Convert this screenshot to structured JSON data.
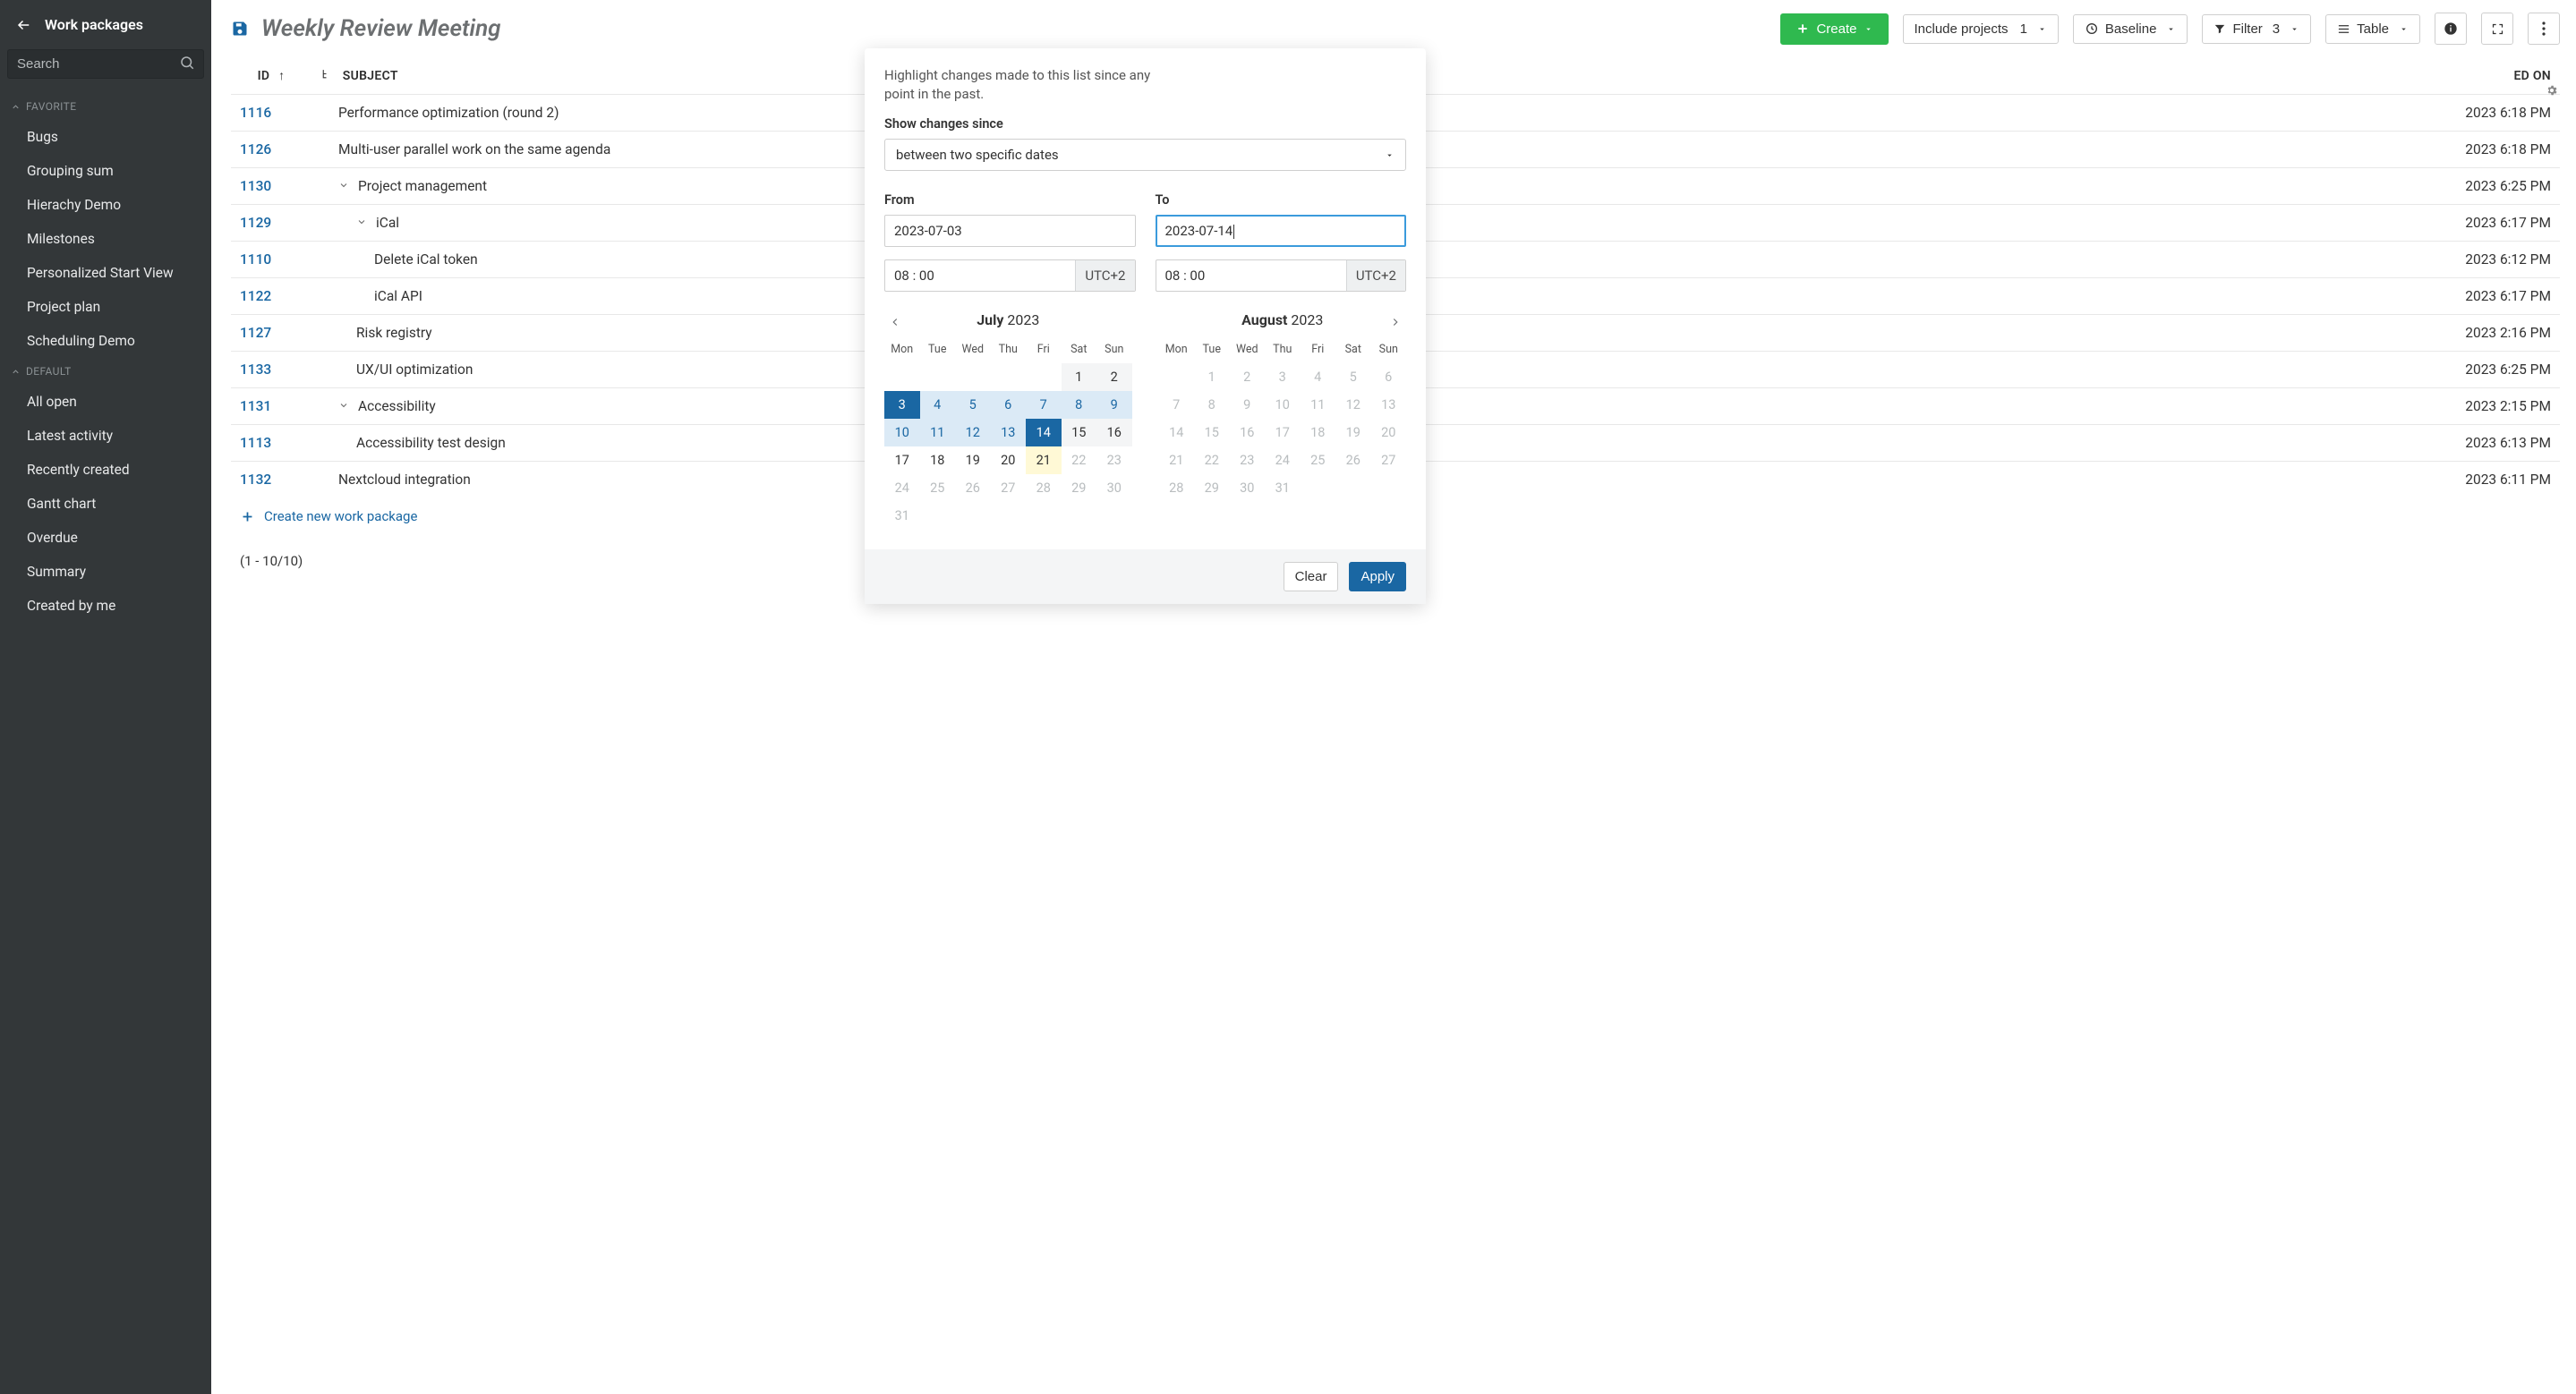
{
  "sidebar": {
    "title": "Work packages",
    "search_placeholder": "Search",
    "section_favorite": "FAVORITE",
    "section_default": "DEFAULT",
    "favorite_items": [
      "Bugs",
      "Grouping sum",
      "Hierachy Demo",
      "Milestones",
      "Personalized Start View",
      "Project plan",
      "Scheduling Demo"
    ],
    "default_items": [
      "All open",
      "Latest activity",
      "Recently created",
      "Gantt chart",
      "Overdue",
      "Summary",
      "Created by me"
    ]
  },
  "toolbar": {
    "page_title": "Weekly Review Meeting",
    "create": "Create",
    "include_projects": "Include projects",
    "include_projects_count": "1",
    "baseline": "Baseline",
    "filter": "Filter",
    "filter_count": "3",
    "table": "Table"
  },
  "table": {
    "col_id": "ID",
    "col_subject": "SUBJECT",
    "col_updated": "ED ON",
    "rows": [
      {
        "id": "1116",
        "subject": "Performance optimization (round 2)",
        "indent": 0,
        "chevron": false,
        "updated": "2023 6:18 PM"
      },
      {
        "id": "1126",
        "subject": "Multi-user parallel work on the same agenda",
        "indent": 0,
        "chevron": false,
        "updated": "2023 6:18 PM"
      },
      {
        "id": "1130",
        "subject": "Project management",
        "indent": 0,
        "chevron": true,
        "updated": "2023 6:25 PM"
      },
      {
        "id": "1129",
        "subject": "iCal",
        "indent": 1,
        "chevron": true,
        "updated": "2023 6:17 PM"
      },
      {
        "id": "1110",
        "subject": "Delete iCal token",
        "indent": 2,
        "chevron": false,
        "updated": "2023 6:12 PM"
      },
      {
        "id": "1122",
        "subject": "iCal API",
        "indent": 2,
        "chevron": false,
        "updated": "2023 6:17 PM"
      },
      {
        "id": "1127",
        "subject": "Risk registry",
        "indent": 1,
        "chevron": false,
        "updated": "2023 2:16 PM"
      },
      {
        "id": "1133",
        "subject": "UX/UI optimization",
        "indent": 1,
        "chevron": false,
        "updated": "2023 6:25 PM"
      },
      {
        "id": "1131",
        "subject": "Accessibility",
        "indent": 0,
        "chevron": true,
        "updated": "2023 2:15 PM"
      },
      {
        "id": "1113",
        "subject": "Accessibility test design",
        "indent": 1,
        "chevron": false,
        "updated": "2023 6:13 PM"
      },
      {
        "id": "1132",
        "subject": "Nextcloud integration",
        "indent": 0,
        "chevron": false,
        "updated": "2023 6:11 PM"
      }
    ],
    "create_new": "Create new work package",
    "footer": "(1 - 10/10)"
  },
  "panel": {
    "hint": "Highlight changes made to this list since any point in the past.",
    "show_changes_label": "Show changes since",
    "mode": "between two specific dates",
    "from_label": "From",
    "to_label": "To",
    "from_date": "2023-07-03",
    "to_date": "2023-07-14",
    "from_time": "08 : 00",
    "to_time": "08 : 00",
    "tz": "UTC+2",
    "clear": "Clear",
    "apply": "Apply",
    "cal1": {
      "month": "July",
      "year": "2023"
    },
    "cal2": {
      "month": "August",
      "year": "2023"
    },
    "dow": [
      "Mon",
      "Tue",
      "Wed",
      "Thu",
      "Fri",
      "Sat",
      "Sun"
    ]
  }
}
